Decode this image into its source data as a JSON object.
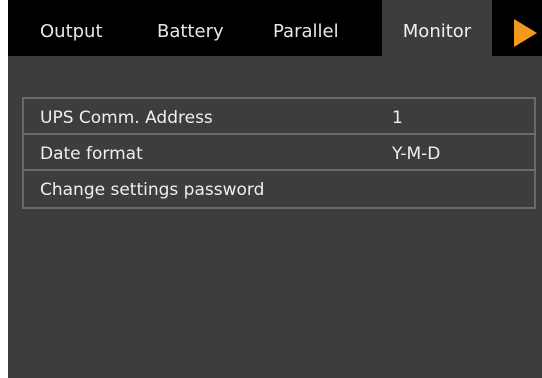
{
  "tabs": [
    {
      "label": "Output",
      "active": false
    },
    {
      "label": "Battery",
      "active": false
    },
    {
      "label": "Parallel",
      "active": false
    },
    {
      "label": "Monitor",
      "active": true
    }
  ],
  "next_arrow_icon": "play-arrow-icon",
  "settings": [
    {
      "label": "UPS Comm. Address",
      "value": "1"
    },
    {
      "label": "Date format",
      "value": "Y-M-D"
    },
    {
      "label": "Change settings password",
      "value": ""
    }
  ],
  "colors": {
    "background": "#3d3d3d",
    "tabbar": "#000000",
    "accent_arrow": "#f39a1e",
    "text": "#efefef"
  }
}
